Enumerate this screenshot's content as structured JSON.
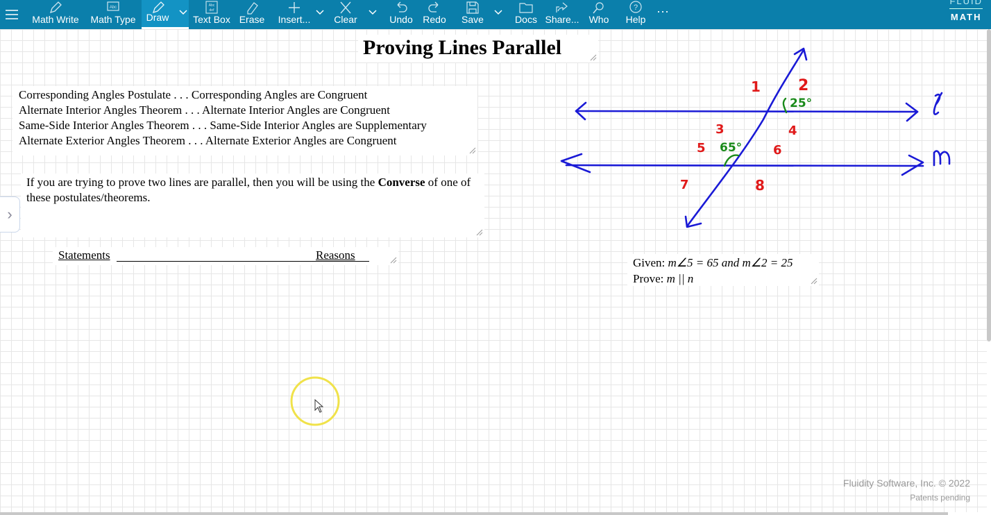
{
  "toolbar": {
    "items": [
      {
        "label": "Math Write",
        "icon": "pencil-icon"
      },
      {
        "label": "Math Type",
        "icon": "abc-keyboard-icon"
      },
      {
        "label": "Draw",
        "icon": "draw-pencil-icon"
      },
      {
        "label": "Text Box",
        "icon": "text-box-icon"
      },
      {
        "label": "Erase",
        "icon": "eraser-icon"
      },
      {
        "label": "Insert...",
        "icon": "plus-icon"
      },
      {
        "label": "Clear",
        "icon": "x-icon"
      },
      {
        "label": "Undo",
        "icon": "undo-icon"
      },
      {
        "label": "Redo",
        "icon": "redo-icon"
      },
      {
        "label": "Save",
        "icon": "save-icon"
      },
      {
        "label": "Docs",
        "icon": "folder-icon"
      },
      {
        "label": "Share...",
        "icon": "share-icon"
      },
      {
        "label": "Who",
        "icon": "search-person-icon"
      },
      {
        "label": "Help",
        "icon": "help-icon"
      }
    ],
    "more": "···",
    "brand_top": "FLUID",
    "brand_bottom": "MATH",
    "accent": "#0b7fab"
  },
  "doc": {
    "title": "Proving Lines Parallel",
    "theorems": [
      "Corresponding Angles Postulate . . . Corresponding Angles are Congruent",
      "Alternate Interior Angles Theorem . . . Alternate Interior Angles are Congruent",
      "Same-Side Interior Angles Theorem . . . Same-Side Interior Angles are Supplementary",
      "Alternate Exterior Angles Theorem . . . Alternate Exterior Angles are Congruent"
    ],
    "converse_pre": "If you are trying to prove two lines are parallel, then you will be using the ",
    "converse_bold": "Converse",
    "converse_post": " of one of these postulates/theorems.",
    "statements": "Statements",
    "reasons": "Reasons",
    "given_label": "Given: ",
    "given_expr": "m∠5 = 65 and m∠2 = 25",
    "prove_label": "Prove: ",
    "prove_expr": "m || n"
  },
  "drawing": {
    "angle_numbers": [
      "1",
      "2",
      "3",
      "4",
      "5",
      "6",
      "7",
      "8"
    ],
    "angle_25": "25°",
    "angle_65": "65°",
    "line_l": "l",
    "line_m": "m",
    "blue": "#1a1ad6",
    "red": "#e01a1a",
    "green": "#1a8a1a"
  },
  "footer": {
    "copyright": "Fluidity Software, Inc. © 2022",
    "patents": "Patents pending"
  },
  "sidebar_toggle": "›"
}
